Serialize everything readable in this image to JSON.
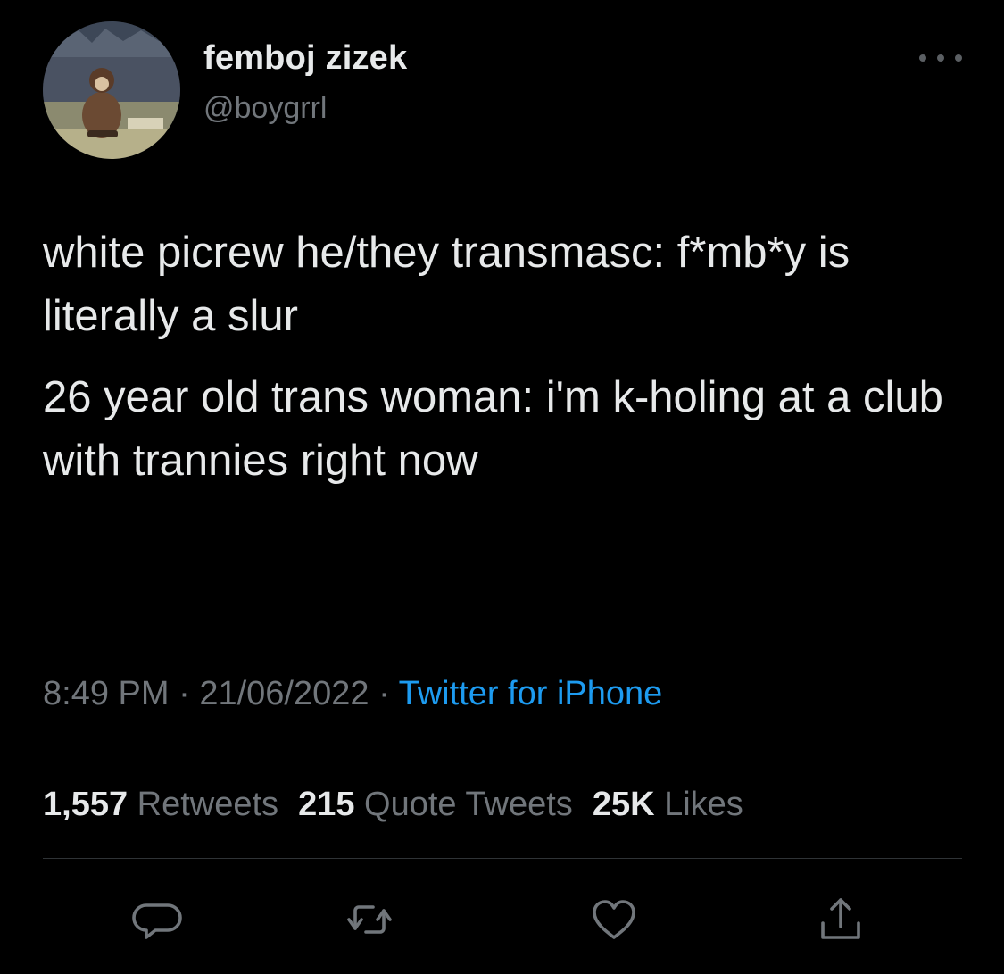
{
  "author": {
    "display_name": "femboj zizek",
    "handle": "@boygrrl",
    "avatar": "avatar-image"
  },
  "more_icon": "more-horizontal-icon",
  "tweet": {
    "paragraphs": [
      "white picrew he/they transmasc: f*mb*y is literally a slur",
      "26 year old trans woman: i'm k-holing at a club with trannies right now"
    ],
    "time": "8:49 PM",
    "date": "21/06/2022",
    "separator": "·",
    "source": "Twitter for iPhone"
  },
  "stats": {
    "retweets_count": "1,557",
    "retweets_label": "Retweets",
    "quote_count": "215",
    "quote_label": "Quote Tweets",
    "likes_count": "25K",
    "likes_label": "Likes"
  },
  "actions": [
    {
      "icon": "reply-icon"
    },
    {
      "icon": "retweet-icon"
    },
    {
      "icon": "like-icon"
    },
    {
      "icon": "share-icon"
    }
  ],
  "colors": {
    "background": "#000000",
    "text_primary": "#e7e9ea",
    "text_secondary": "#71767b",
    "link": "#1d9bf0",
    "divider": "#2f3336"
  }
}
